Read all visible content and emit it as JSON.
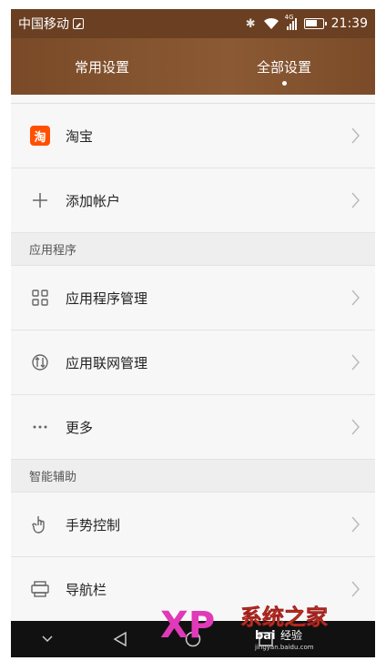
{
  "status": {
    "carrier": "中国移动",
    "network_label": "4G",
    "time": "21:39"
  },
  "tabs": [
    {
      "label": "常用设置",
      "active": false
    },
    {
      "label": "全部设置",
      "active": true
    }
  ],
  "accounts": {
    "items": [
      {
        "label": "淘宝",
        "icon": "taobao-icon",
        "icon_text": "淘"
      },
      {
        "label": "添加帐户",
        "icon": "plus-icon"
      }
    ]
  },
  "apps": {
    "header": "应用程序",
    "items": [
      {
        "label": "应用程序管理",
        "icon": "grid-icon"
      },
      {
        "label": "应用联网管理",
        "icon": "network-icon"
      },
      {
        "label": "更多",
        "icon": "more-icon"
      }
    ]
  },
  "assist": {
    "header": "智能辅助",
    "items": [
      {
        "label": "手势控制",
        "icon": "gesture-icon"
      },
      {
        "label": "导航栏",
        "icon": "navbar-icon"
      }
    ]
  },
  "watermark": {
    "logo_text": "XP",
    "title": "系统之家",
    "sub": "jingyan.baidu.com",
    "baidu": "bai",
    "baidu_suffix": "经验"
  },
  "colors": {
    "header_brown": "#7a4a28",
    "taobao_orange": "#ff5000"
  }
}
